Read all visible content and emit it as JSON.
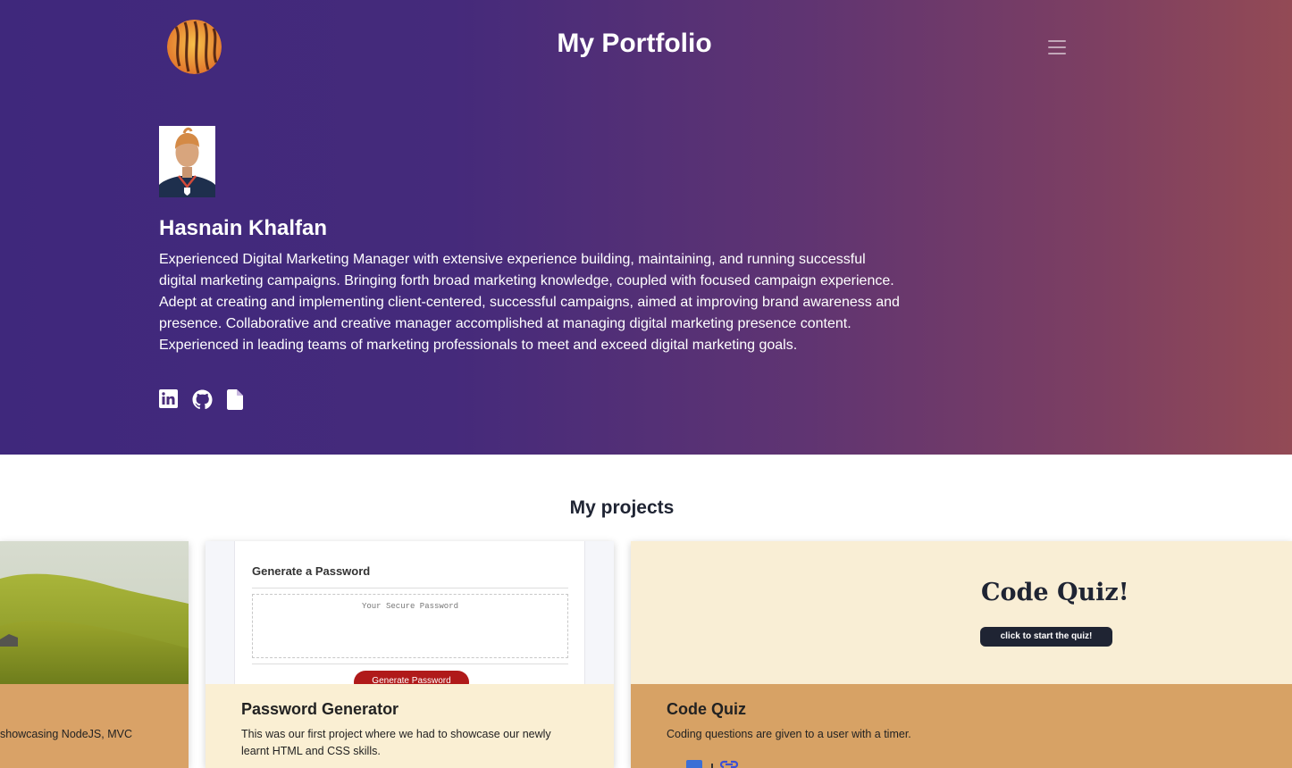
{
  "header": {
    "title": "My Portfolio",
    "logo_icon": "striped-orb-logo",
    "menu_icon": "hamburger-menu-icon"
  },
  "profile": {
    "name": "Hasnain Khalfan",
    "bio": "Experienced Digital Marketing Manager with extensive experience building, maintaining, and running successful digital marketing campaigns. Bringing forth broad marketing knowledge, coupled with focused campaign experience. Adept at creating and implementing client-centered, successful campaigns, aimed at improving brand awareness and presence. Collaborative and creative manager accomplished at managing digital marketing presence content. Experienced in leading teams of marketing professionals to meet and exceed digital marketing goals.",
    "socials": [
      "linkedin-icon",
      "github-icon",
      "resume-file-icon"
    ]
  },
  "projects": {
    "heading": "My projects",
    "cards": [
      {
        "title": "",
        "description": "showcasing NodeJS, MVC",
        "image": "green-hills-landscape"
      },
      {
        "title": "Password Generator",
        "description": "This was our first project where we had to showcase our newly learnt HTML and CSS skills.",
        "preview": {
          "heading": "Generate a Password",
          "placeholder": "Your Secure Password",
          "button": "Generate Password"
        }
      },
      {
        "title": "Code Quiz",
        "description": "Coding questions are given to a user with a timer.",
        "preview": {
          "heading": "Code Quiz!",
          "button": "click to start the quiz!"
        },
        "icons": [
          "github-link-icon",
          "external-link-icon"
        ]
      }
    ]
  },
  "colors": {
    "hero_gradient_start": "#3f287c",
    "hero_gradient_end": "#934a55",
    "card_tan": "#d9a267",
    "card_cream": "#faefd3"
  }
}
